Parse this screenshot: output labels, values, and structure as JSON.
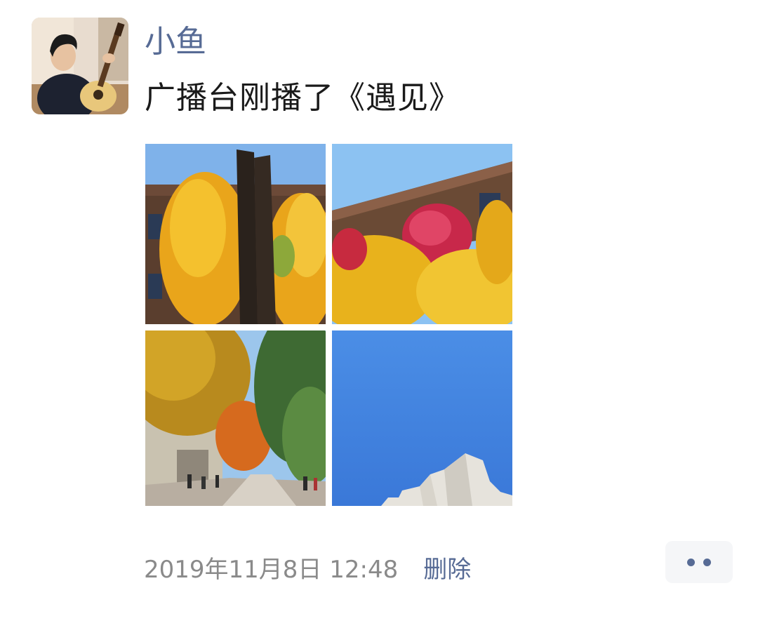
{
  "post": {
    "author": "小鱼",
    "content": "广播台刚播了《遇见》",
    "timestamp": "2019年11月8日 12:48",
    "delete_label": "删除",
    "photos": [
      {
        "icon": "photo-ginkgo-trees-and-trunk"
      },
      {
        "icon": "photo-red-and-yellow-leaves-building"
      },
      {
        "icon": "photo-tree-lined-road"
      },
      {
        "icon": "photo-blue-sky-building"
      }
    ]
  },
  "colors": {
    "name_link": "#576b95",
    "text": "#1a1a1a",
    "timestamp": "#8a8a8a",
    "more_button_bg": "#f5f6f8"
  }
}
